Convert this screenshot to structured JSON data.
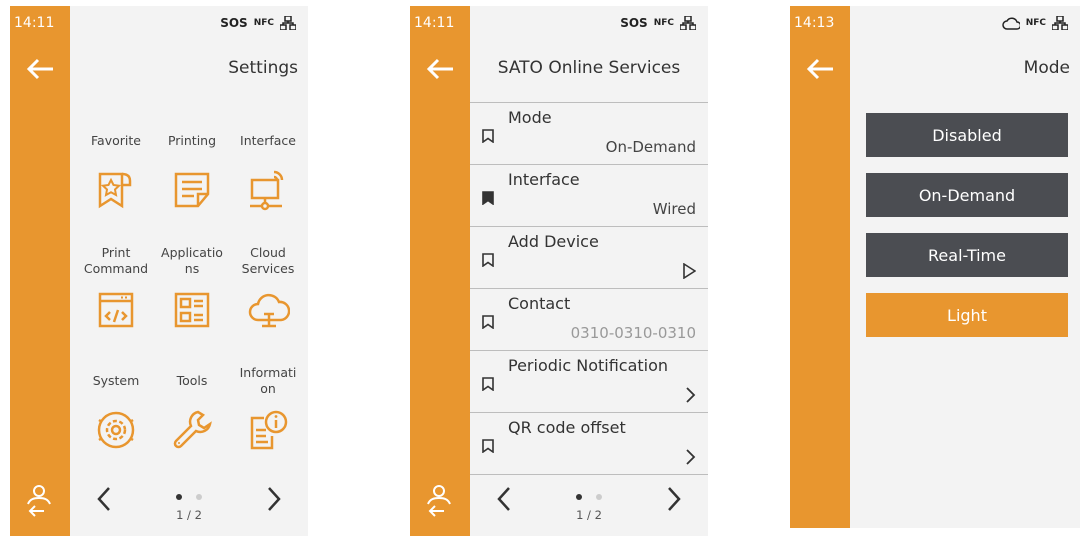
{
  "colors": {
    "accent": "#e8962f",
    "panel": "#f3f3f3",
    "button": "#4b4d52"
  },
  "screen1": {
    "time": "14:11",
    "status": {
      "sos": "SOS",
      "nfc": "NFC",
      "network_icon": "network-icon"
    },
    "title": "Settings",
    "items": [
      {
        "label": "Favorite",
        "icon": "favorite-icon"
      },
      {
        "label": "Printing",
        "icon": "printing-icon"
      },
      {
        "label": "Interface",
        "icon": "interface-icon"
      },
      {
        "label": "Print Command",
        "icon": "print-command-icon"
      },
      {
        "label": "Applicatio ns",
        "icon": "applications-icon"
      },
      {
        "label": "Cloud Services",
        "icon": "cloud-services-icon"
      },
      {
        "label": "System",
        "icon": "system-icon"
      },
      {
        "label": "Tools",
        "icon": "tools-icon"
      },
      {
        "label": "Informati on",
        "icon": "information-icon"
      }
    ],
    "page": "1 / 2"
  },
  "screen2": {
    "time": "14:11",
    "status": {
      "sos": "SOS",
      "nfc": "NFC"
    },
    "title": "SATO Online Services",
    "rows": [
      {
        "name": "Mode",
        "value": "On-Demand",
        "bookmarked": false
      },
      {
        "name": "Interface",
        "value": "Wired",
        "bookmarked": true
      },
      {
        "name": "Add Device",
        "value": "",
        "bookmarked": false
      },
      {
        "name": "Contact",
        "value": "0310-0310-0310",
        "bookmarked": false
      },
      {
        "name": "Periodic Notification",
        "value": "",
        "bookmarked": false
      },
      {
        "name": "QR code offset",
        "value": "",
        "bookmarked": false
      }
    ],
    "page": "1 / 2"
  },
  "screen3": {
    "time": "14:13",
    "status": {
      "nfc": "NFC"
    },
    "title": "Mode",
    "options": [
      "Disabled",
      "On-Demand",
      "Real-Time",
      "Light"
    ],
    "selected": "Light"
  }
}
